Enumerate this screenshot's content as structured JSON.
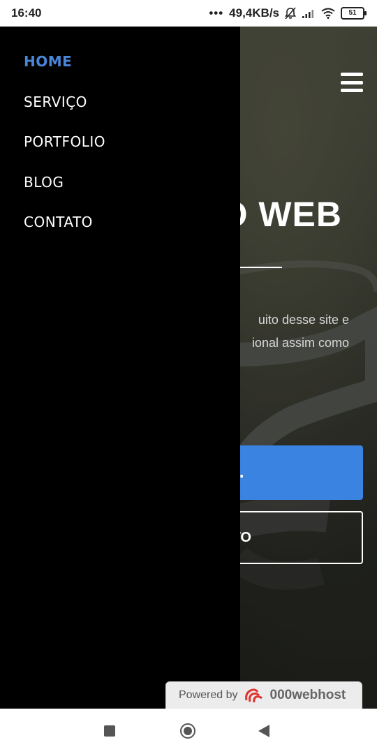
{
  "status_bar": {
    "time": "16:40",
    "dots": "•••",
    "speed": "49,4KB/s",
    "battery": "51"
  },
  "hero": {
    "title": "O WEB",
    "text_line1": "uito desse site e",
    "text_line2": "ional assim como",
    "primary_button": ".",
    "outline_button": "TO"
  },
  "menu": {
    "items": [
      {
        "label": "HOME",
        "active": true
      },
      {
        "label": "SERVIÇO"
      },
      {
        "label": "PORTFOLIO"
      },
      {
        "label": "BLOG"
      },
      {
        "label": "CONTATO"
      }
    ]
  },
  "powered": {
    "by": "Powered by",
    "brand": "000webhost"
  },
  "colors": {
    "accent": "#3a83e0",
    "active_menu": "#4a86d8",
    "drawer": "#000000"
  }
}
